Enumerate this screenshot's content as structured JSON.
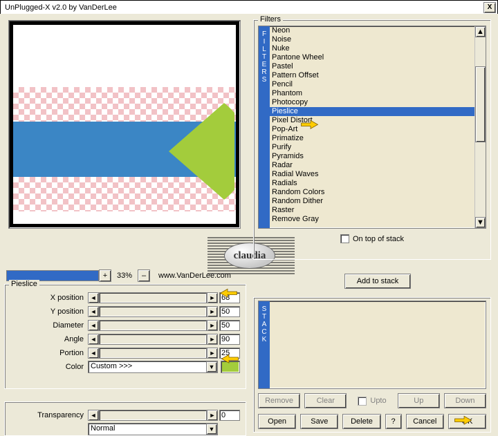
{
  "window": {
    "title": "UnPlugged-X v2.0 by VanDerLee",
    "close": "X"
  },
  "zoom": {
    "percent": "33%",
    "fill_pct": 33,
    "plus": "+",
    "minus": "–"
  },
  "brand": {
    "site": "www.VanDerLee.com",
    "logo_text": "claudia"
  },
  "params": {
    "group_label": "Pieslice",
    "rows": [
      {
        "label": "X position",
        "value": "68"
      },
      {
        "label": "Y position",
        "value": "50"
      },
      {
        "label": "Diameter",
        "value": "50"
      },
      {
        "label": "Angle",
        "value": "90"
      },
      {
        "label": "Portion",
        "value": "25"
      }
    ],
    "color_label": "Color",
    "color_combo": "Custom >>>",
    "swatch": "#a3cc3c"
  },
  "transparency": {
    "label": "Transparency",
    "value": "0",
    "mode": "Normal"
  },
  "filters": {
    "label": "Filters",
    "side_label": [
      "F",
      "I",
      "L",
      "T",
      "E",
      "R",
      "S"
    ],
    "items": [
      "Neon",
      "Noise",
      "Nuke",
      "Pantone Wheel",
      "Pastel",
      "Pattern Offset",
      "Pencil",
      "Phantom",
      "Photocopy",
      "Pieslice",
      "Pixel Distort",
      "Pop-Art",
      "Primatize",
      "Purify",
      "Pyramids",
      "Radar",
      "Radial Waves",
      "Radials",
      "Random Colors",
      "Random Dither",
      "Raster",
      "Remove Gray"
    ],
    "selected": "Pieslice",
    "on_top": "On top of stack"
  },
  "stack": {
    "side_label": [
      "S",
      "T",
      "A",
      "C",
      "K"
    ],
    "add": "Add to stack",
    "buttons": {
      "remove": "Remove",
      "clear": "Clear",
      "upto": "Upto",
      "up": "Up",
      "down": "Down"
    },
    "bottom": {
      "open": "Open",
      "save": "Save",
      "delete": "Delete",
      "q": "?",
      "cancel": "Cancel",
      "ok": "OK"
    }
  },
  "colors": {
    "accent": "#316ac5",
    "pieslice": "#a3cc3c",
    "bar": "#3b86c5"
  }
}
